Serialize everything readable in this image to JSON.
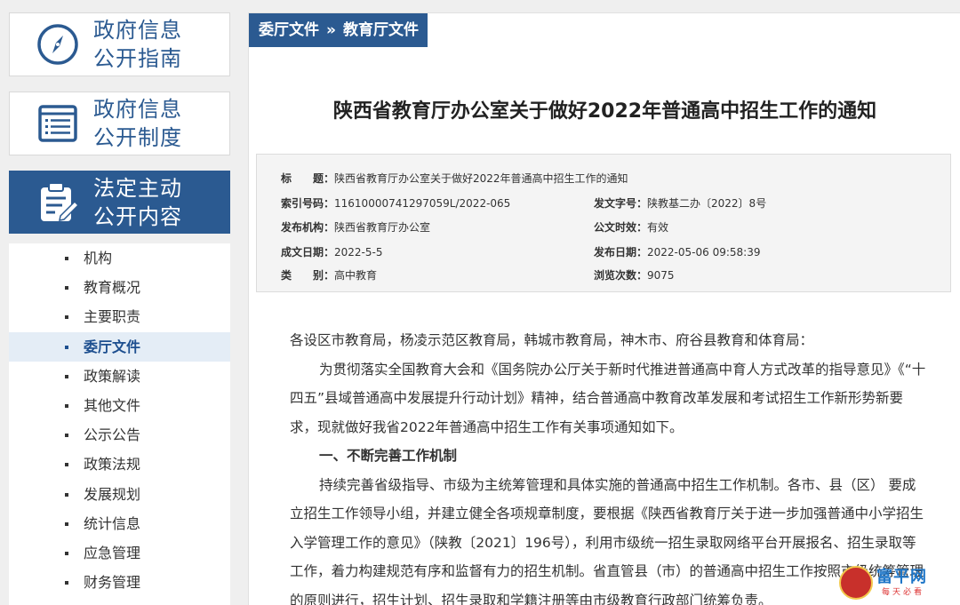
{
  "sidebar": {
    "boxes": [
      {
        "line1": "政府信息",
        "line2": "公开指南",
        "icon": "compass-icon"
      },
      {
        "line1": "政府信息",
        "line2": "公开制度",
        "icon": "list-document-icon"
      },
      {
        "line1": "法定主动",
        "line2": "公开内容",
        "icon": "clipboard-edit-icon"
      }
    ],
    "items": [
      {
        "label": "机构"
      },
      {
        "label": "教育概况"
      },
      {
        "label": "主要职责"
      },
      {
        "label": "委厅文件"
      },
      {
        "label": "政策解读"
      },
      {
        "label": "其他文件"
      },
      {
        "label": "公示公告"
      },
      {
        "label": "政策法规"
      },
      {
        "label": "发展规划"
      },
      {
        "label": "统计信息"
      },
      {
        "label": "应急管理"
      },
      {
        "label": "财务管理"
      }
    ],
    "current_item": "委厅文件"
  },
  "breadcrumb": {
    "part1": "委厅文件",
    "separator": "»",
    "part2": "教育厅文件"
  },
  "document": {
    "title": "陕西省教育厅办公室关于做好2022年普通高中招生工作的通知",
    "meta": {
      "title_label": "标　　题：",
      "title_value": "陕西省教育厅办公室关于做好2022年普通高中招生工作的通知",
      "index_label": "索引号码：",
      "index_value": "11610000741297059L/2022-065",
      "doc_no_label": "发文字号：",
      "doc_no_value": "陕教基二办〔2022〕8号",
      "issuer_label": "发布机构：",
      "issuer_value": "陕西省教育厅办公室",
      "validity_label": "公文时效：",
      "validity_value": "有效",
      "created_label": "成文日期：",
      "created_value": "2022-5-5",
      "published_label": "发布日期：",
      "published_value": "2022-05-06 09:58:39",
      "category_label": "类　　别：",
      "category_value": "高中教育",
      "views_label": "浏览次数：",
      "views_value": "9075"
    },
    "paragraphs": {
      "salutation": "各设区市教育局，杨凌示范区教育局，韩城市教育局，神木市、府谷县教育和体育局：",
      "intro": "为贯彻落实全国教育大会和《国务院办公厅关于新时代推进普通高中育人方式改革的指导意见》《“十四五”县域普通高中发展提升行动计划》精神，结合普通高中教育改革发展和考试招生工作新形势新要求，现就做好我省2022年普通高中招生工作有关事项通知如下。",
      "heading1": "一、不断完善工作机制",
      "para1": "持续完善省级指导、市级为主统筹管理和具体实施的普通高中招生工作机制。各市、县（区） 要成立招生工作领导小组，并建立健全各项规章制度，要根据《陕西省教育厅关于进一步加强普通中小学招生入学管理工作的意见》（陕教〔2021〕196号），利用市级统一招生录取网络平台开展报名、招生录取等工作，着力构建规范有序和监督有力的招生机制。省直管县（市）的普通高中招生工作按照市级统筹管理的原则进行，招生计划、招生录取和学籍注册等由市级教育行政部门统筹负责。"
    }
  },
  "watermark": {
    "brand": "富平网",
    "slogan": "每天必看"
  },
  "colors": {
    "primary": "#2b5a91",
    "highlight_bg": "#e4edf6",
    "text": "#333333"
  }
}
